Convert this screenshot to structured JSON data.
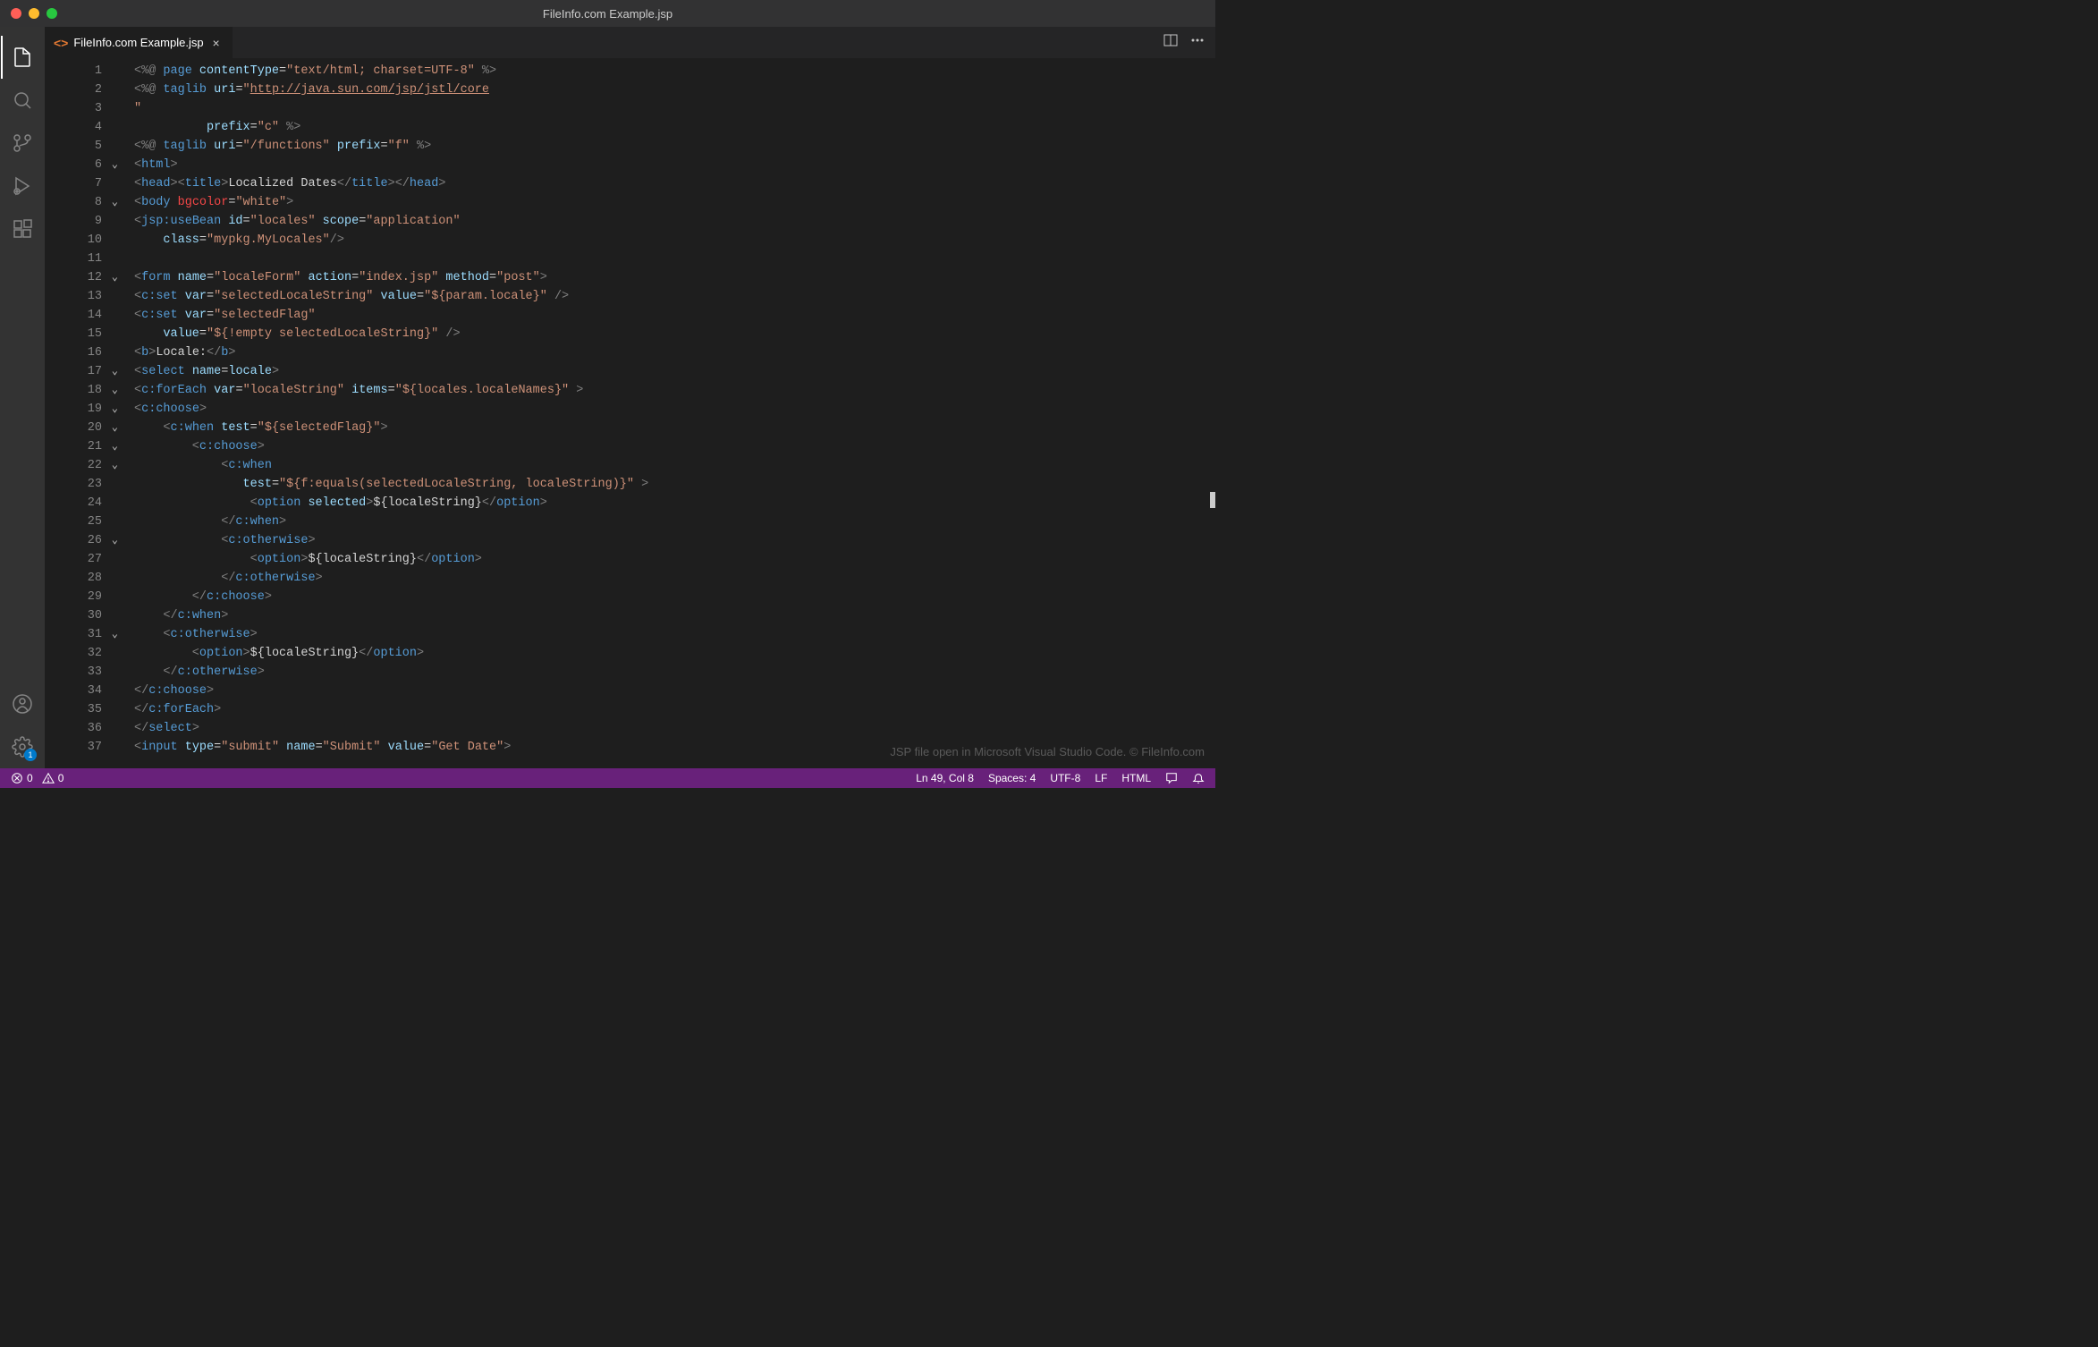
{
  "window": {
    "title": "FileInfo.com Example.jsp"
  },
  "tabs": [
    {
      "label": "FileInfo.com Example.jsp",
      "icon": "jsp"
    }
  ],
  "activity_badge": "1",
  "gutter": {
    "start": 1,
    "end": 37,
    "folds": [
      6,
      8,
      12,
      17,
      18,
      19,
      20,
      21,
      22,
      26,
      31
    ]
  },
  "code": {
    "lines": [
      [
        [
          "<%@",
          "bracket"
        ],
        [
          " page ",
          "jsp"
        ],
        [
          "contentType",
          "attr"
        ],
        [
          "=",
          "text"
        ],
        [
          "\"text/html; charset=UTF-8\"",
          "val"
        ],
        [
          " %>",
          "bracket"
        ]
      ],
      [
        [
          "<%@",
          "bracket"
        ],
        [
          " taglib ",
          "jsp"
        ],
        [
          "uri",
          "attr"
        ],
        [
          "=",
          "text"
        ],
        [
          "\"",
          "val"
        ],
        [
          "http://java.sun.com/jsp/jstl/core",
          "val underline"
        ]
      ],
      [
        [
          "\"",
          "val"
        ]
      ],
      [
        [
          "          ",
          "text"
        ],
        [
          "prefix",
          "attr"
        ],
        [
          "=",
          "text"
        ],
        [
          "\"c\"",
          "val"
        ],
        [
          " %>",
          "bracket"
        ]
      ],
      [
        [
          "<%@",
          "bracket"
        ],
        [
          " taglib ",
          "jsp"
        ],
        [
          "uri",
          "attr"
        ],
        [
          "=",
          "text"
        ],
        [
          "\"/functions\"",
          "val"
        ],
        [
          " ",
          "text"
        ],
        [
          "prefix",
          "attr"
        ],
        [
          "=",
          "text"
        ],
        [
          "\"f\"",
          "val"
        ],
        [
          " %>",
          "bracket"
        ]
      ],
      [
        [
          "<",
          "bracket"
        ],
        [
          "html",
          "tag"
        ],
        [
          ">",
          "bracket"
        ]
      ],
      [
        [
          "<",
          "bracket"
        ],
        [
          "head",
          "tag"
        ],
        [
          "><",
          "bracket"
        ],
        [
          "title",
          "tag"
        ],
        [
          ">",
          "bracket"
        ],
        [
          "Localized Dates",
          "text"
        ],
        [
          "</",
          "bracket"
        ],
        [
          "title",
          "tag"
        ],
        [
          "></",
          "bracket"
        ],
        [
          "head",
          "tag"
        ],
        [
          ">",
          "bracket"
        ]
      ],
      [
        [
          "<",
          "bracket"
        ],
        [
          "body ",
          "tag"
        ],
        [
          "bgcolor",
          "deprecated"
        ],
        [
          "=",
          "text"
        ],
        [
          "\"white\"",
          "val"
        ],
        [
          ">",
          "bracket"
        ]
      ],
      [
        [
          "<",
          "bracket"
        ],
        [
          "jsp:useBean ",
          "tag"
        ],
        [
          "id",
          "attr"
        ],
        [
          "=",
          "text"
        ],
        [
          "\"locales\"",
          "val"
        ],
        [
          " ",
          "text"
        ],
        [
          "scope",
          "attr"
        ],
        [
          "=",
          "text"
        ],
        [
          "\"application\"",
          "val"
        ]
      ],
      [
        [
          "    ",
          "text"
        ],
        [
          "class",
          "attr"
        ],
        [
          "=",
          "text"
        ],
        [
          "\"mypkg.MyLocales\"",
          "val"
        ],
        [
          "/>",
          "bracket"
        ]
      ],
      [
        [
          "",
          "text"
        ]
      ],
      [
        [
          "<",
          "bracket"
        ],
        [
          "form ",
          "tag"
        ],
        [
          "name",
          "attr"
        ],
        [
          "=",
          "text"
        ],
        [
          "\"localeForm\"",
          "val"
        ],
        [
          " ",
          "text"
        ],
        [
          "action",
          "attr"
        ],
        [
          "=",
          "text"
        ],
        [
          "\"index.jsp\"",
          "val"
        ],
        [
          " ",
          "text"
        ],
        [
          "method",
          "attr"
        ],
        [
          "=",
          "text"
        ],
        [
          "\"post\"",
          "val"
        ],
        [
          ">",
          "bracket"
        ]
      ],
      [
        [
          "<",
          "bracket"
        ],
        [
          "c",
          ""
        ],
        [
          ":set ",
          "tag"
        ],
        [
          "var",
          "attr"
        ],
        [
          "=",
          "text"
        ],
        [
          "\"selectedLocaleString\"",
          "val"
        ],
        [
          " ",
          "text"
        ],
        [
          "value",
          "attr"
        ],
        [
          "=",
          "text"
        ],
        [
          "\"${param.locale}\"",
          "val"
        ],
        [
          " />",
          "bracket"
        ]
      ],
      [
        [
          "<",
          "bracket"
        ],
        [
          "c",
          ""
        ],
        [
          ":set ",
          "tag"
        ],
        [
          "var",
          "attr"
        ],
        [
          "=",
          "text"
        ],
        [
          "\"selectedFlag\"",
          "val"
        ]
      ],
      [
        [
          "    ",
          "text"
        ],
        [
          "value",
          "attr"
        ],
        [
          "=",
          "text"
        ],
        [
          "\"${!empty selectedLocaleString}\"",
          "val"
        ],
        [
          " />",
          "bracket"
        ]
      ],
      [
        [
          "<",
          "bracket"
        ],
        [
          "b",
          "tag"
        ],
        [
          ">",
          "bracket"
        ],
        [
          "Locale:",
          "text"
        ],
        [
          "</",
          "bracket"
        ],
        [
          "b",
          "tag"
        ],
        [
          ">",
          "bracket"
        ]
      ],
      [
        [
          "<",
          "bracket"
        ],
        [
          "select ",
          "tag"
        ],
        [
          "name",
          "attr"
        ],
        [
          "=",
          "text"
        ],
        [
          "locale",
          "attr"
        ],
        [
          ">",
          "bracket"
        ]
      ],
      [
        [
          "<",
          "bracket"
        ],
        [
          "c",
          ""
        ],
        [
          ":forEach ",
          "tag"
        ],
        [
          "var",
          "attr"
        ],
        [
          "=",
          "text"
        ],
        [
          "\"localeString\"",
          "val"
        ],
        [
          " ",
          "text"
        ],
        [
          "items",
          "attr"
        ],
        [
          "=",
          "text"
        ],
        [
          "\"${locales.localeNames}\"",
          "val"
        ],
        [
          " >",
          "bracket"
        ]
      ],
      [
        [
          "<",
          "bracket"
        ],
        [
          "c",
          ""
        ],
        [
          ":choose",
          "tag"
        ],
        [
          ">",
          "bracket"
        ]
      ],
      [
        [
          "    <",
          "bracket"
        ],
        [
          "c",
          ""
        ],
        [
          ":when ",
          "tag"
        ],
        [
          "test",
          "attr"
        ],
        [
          "=",
          "text"
        ],
        [
          "\"${selectedFlag}\"",
          "val"
        ],
        [
          ">",
          "bracket"
        ]
      ],
      [
        [
          "        <",
          "bracket"
        ],
        [
          "c",
          ""
        ],
        [
          ":choose",
          "tag"
        ],
        [
          ">",
          "bracket"
        ]
      ],
      [
        [
          "            <",
          "bracket"
        ],
        [
          "c",
          ""
        ],
        [
          ":when",
          "tag"
        ]
      ],
      [
        [
          "               ",
          "text"
        ],
        [
          "test",
          "attr"
        ],
        [
          "=",
          "text"
        ],
        [
          "\"${f:equals(selectedLocaleString, localeString)}\"",
          "val"
        ],
        [
          " >",
          "bracket"
        ]
      ],
      [
        [
          "                <",
          "bracket"
        ],
        [
          "option ",
          "tag"
        ],
        [
          "selected",
          "attr"
        ],
        [
          ">",
          "bracket"
        ],
        [
          "${localeString}",
          "text"
        ],
        [
          "</",
          "bracket"
        ],
        [
          "option",
          "tag"
        ],
        [
          ">",
          "bracket"
        ]
      ],
      [
        [
          "            </",
          "bracket"
        ],
        [
          "c",
          ""
        ],
        [
          ":when",
          "tag"
        ],
        [
          ">",
          "bracket"
        ]
      ],
      [
        [
          "            <",
          "bracket"
        ],
        [
          "c",
          ""
        ],
        [
          ":otherwise",
          "tag"
        ],
        [
          ">",
          "bracket"
        ]
      ],
      [
        [
          "                <",
          "bracket"
        ],
        [
          "option",
          "tag"
        ],
        [
          ">",
          "bracket"
        ],
        [
          "${localeString}",
          "text"
        ],
        [
          "</",
          "bracket"
        ],
        [
          "option",
          "tag"
        ],
        [
          ">",
          "bracket"
        ]
      ],
      [
        [
          "            </",
          "bracket"
        ],
        [
          "c",
          ""
        ],
        [
          ":otherwise",
          "tag"
        ],
        [
          ">",
          "bracket"
        ]
      ],
      [
        [
          "        </",
          "bracket"
        ],
        [
          "c",
          ""
        ],
        [
          ":choose",
          "tag"
        ],
        [
          ">",
          "bracket"
        ]
      ],
      [
        [
          "    </",
          "bracket"
        ],
        [
          "c",
          ""
        ],
        [
          ":when",
          "tag"
        ],
        [
          ">",
          "bracket"
        ]
      ],
      [
        [
          "    <",
          "bracket"
        ],
        [
          "c",
          ""
        ],
        [
          ":otherwise",
          "tag"
        ],
        [
          ">",
          "bracket"
        ]
      ],
      [
        [
          "        <",
          "bracket"
        ],
        [
          "option",
          "tag"
        ],
        [
          ">",
          "bracket"
        ],
        [
          "${localeString}",
          "text"
        ],
        [
          "</",
          "bracket"
        ],
        [
          "option",
          "tag"
        ],
        [
          ">",
          "bracket"
        ]
      ],
      [
        [
          "    </",
          "bracket"
        ],
        [
          "c",
          ""
        ],
        [
          ":otherwise",
          "tag"
        ],
        [
          ">",
          "bracket"
        ]
      ],
      [
        [
          "</",
          "bracket"
        ],
        [
          "c",
          ""
        ],
        [
          ":choose",
          "tag"
        ],
        [
          ">",
          "bracket"
        ]
      ],
      [
        [
          "</",
          "bracket"
        ],
        [
          "c",
          ""
        ],
        [
          ":forEach",
          "tag"
        ],
        [
          ">",
          "bracket"
        ]
      ],
      [
        [
          "</",
          "bracket"
        ],
        [
          "select",
          "tag"
        ],
        [
          ">",
          "bracket"
        ]
      ],
      [
        [
          "<",
          "bracket"
        ],
        [
          "input ",
          "tag"
        ],
        [
          "type",
          "attr"
        ],
        [
          "=",
          "text"
        ],
        [
          "\"submit\"",
          "val"
        ],
        [
          " ",
          "text"
        ],
        [
          "name",
          "attr"
        ],
        [
          "=",
          "text"
        ],
        [
          "\"Submit\"",
          "val"
        ],
        [
          " ",
          "text"
        ],
        [
          "value",
          "attr"
        ],
        [
          "=",
          "text"
        ],
        [
          "\"Get Date\"",
          "val"
        ],
        [
          ">",
          "bracket"
        ]
      ]
    ]
  },
  "watermark": "JSP file open in Microsoft Visual Studio Code. © FileInfo.com",
  "status": {
    "errors": "0",
    "warnings": "0",
    "cursor": "Ln 49, Col 8",
    "indent": "Spaces: 4",
    "encoding": "UTF-8",
    "eol": "LF",
    "language": "HTML"
  }
}
